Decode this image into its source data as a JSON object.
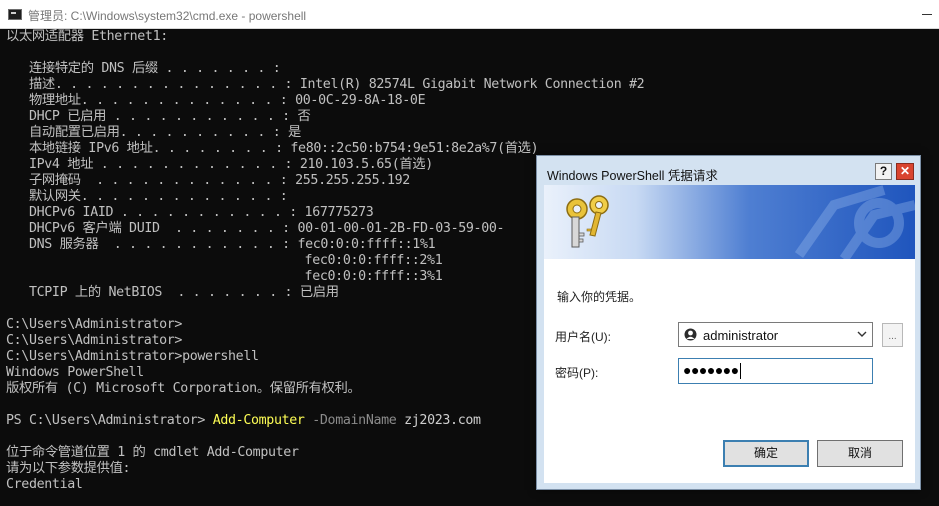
{
  "window": {
    "title": "管理员: C:\\Windows\\system32\\cmd.exe - powershell"
  },
  "console": {
    "lines": [
      "以太网适配器 Ethernet1:",
      "",
      "   连接特定的 DNS 后缀 . . . . . . . :",
      "   描述. . . . . . . . . . . . . . . : Intel(R) 82574L Gigabit Network Connection #2",
      "   物理地址. . . . . . . . . . . . . : 00-0C-29-8A-18-0E",
      "   DHCP 已启用 . . . . . . . . . . . : 否",
      "   自动配置已启用. . . . . . . . . . : 是",
      "   本地链接 IPv6 地址. . . . . . . . : fe80::2c50:b754:9e51:8e2a%7(首选)",
      "   IPv4 地址 . . . . . . . . . . . . : 210.103.5.65(首选)",
      "   子网掩码  . . . . . . . . . . . . : 255.255.255.192",
      "   默认网关. . . . . . . . . . . . . :",
      "   DHCPv6 IAID . . . . . . . . . . . : 167775273",
      "   DHCPv6 客户端 DUID  . . . . . . . : 00-01-00-01-2B-FD-03-59-00-",
      "   DNS 服务器  . . . . . . . . . . . : fec0:0:0:ffff::1%1",
      "                                       fec0:0:0:ffff::2%1",
      "                                       fec0:0:0:ffff::3%1",
      "   TCPIP 上的 NetBIOS  . . . . . . . : 已启用",
      "",
      "C:\\Users\\Administrator>",
      "C:\\Users\\Administrator>",
      "C:\\Users\\Administrator>powershell",
      "Windows PowerShell",
      "版权所有 (C) Microsoft Corporation。保留所有权利。",
      "",
      "",
      "",
      "位于命令管道位置 1 的 cmdlet Add-Computer",
      "请为以下参数提供值:",
      "Credential"
    ],
    "ps_prompt": "PS C:\\Users\\Administrator> ",
    "ps_command": "Add-Computer",
    "ps_param": " -DomainName",
    "ps_arg": " zj2023.com"
  },
  "dialog": {
    "title": "Windows PowerShell 凭据请求",
    "help_label": "?",
    "close_label": "✕",
    "prompt": "输入你的凭据。",
    "username_label": "用户名(U):",
    "username_value": "administrator",
    "password_label": "密码(P):",
    "password_value": "●●●●●●●",
    "browse_label": "...",
    "ok_label": "确定",
    "cancel_label": "取消",
    "icons": {
      "banner": "keys-icon",
      "user": "user-icon",
      "dropdown": "chevron-down-icon"
    }
  },
  "colors": {
    "console_bg": "#0c0c0c",
    "console_text": "#c0c0c0",
    "ps_command": "#fdfd55",
    "ps_param": "#8b8b8b",
    "dialog_frame": "#d3e2f1",
    "close_button": "#d9442f"
  }
}
